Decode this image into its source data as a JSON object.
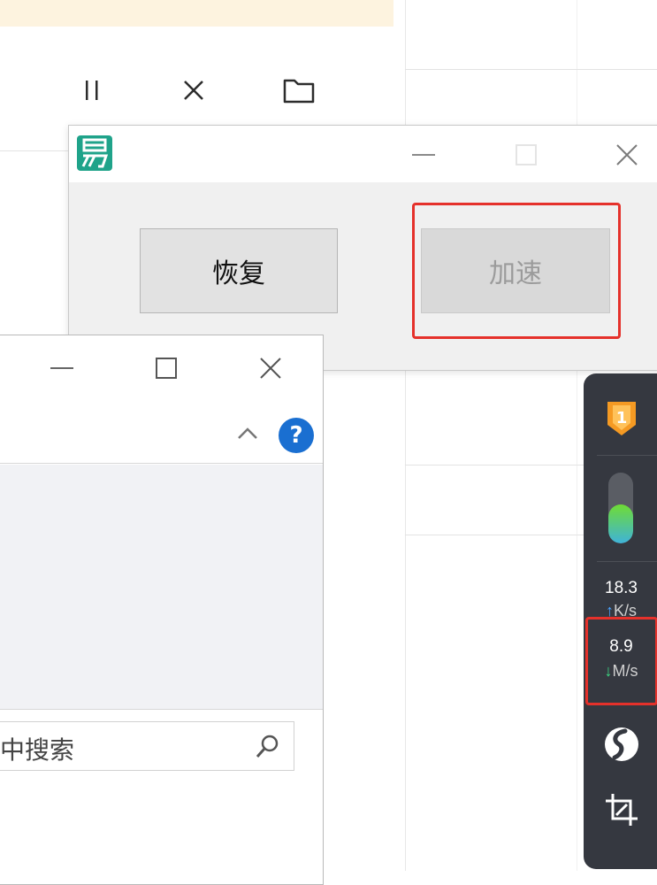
{
  "popup": {
    "title_logo": "app-logo",
    "buttons": {
      "restore_label": "恢复",
      "speedup_label": "加速"
    }
  },
  "explorer": {
    "search_placeholder": "中搜索",
    "help_label": "?"
  },
  "widget": {
    "upload_speed": "18.3",
    "upload_unit": "K/s",
    "download_speed": "8.9",
    "download_unit": "M/s",
    "badge_number": "1",
    "level_fraction": 0.55,
    "highlight_color": "#e5312b"
  }
}
